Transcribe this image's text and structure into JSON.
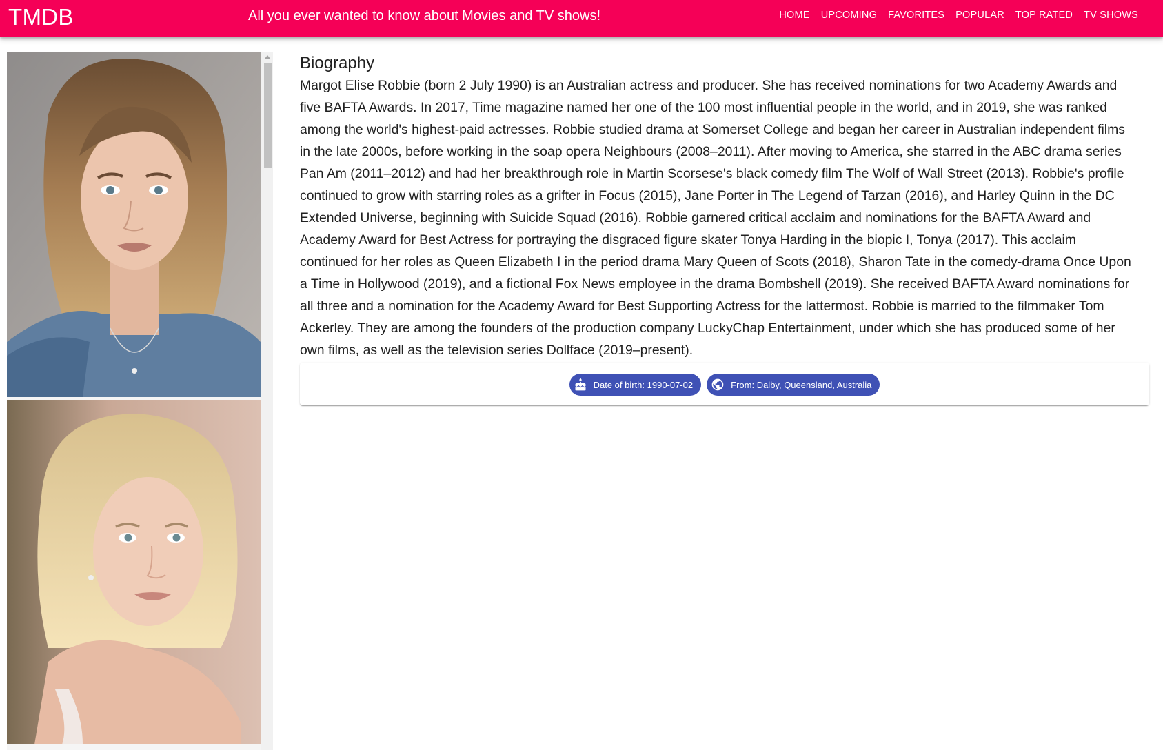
{
  "header": {
    "brand": "TMDB",
    "tagline": "All you ever wanted to know about Movies and TV shows!",
    "nav": [
      "HOME",
      "UPCOMING",
      "FAVORITES",
      "POPULAR",
      "TOP RATED",
      "TV SHOWS"
    ],
    "color": "#f50057"
  },
  "biography": {
    "title": "Biography",
    "text": "Margot Elise Robbie (born 2 July 1990) is an Australian actress and producer. She has received nominations for two Academy Awards and five BAFTA Awards. In 2017, Time magazine named her one of the 100 most influential people in the world, and in 2019, she was ranked among the world's highest-paid actresses. Robbie studied drama at Somerset College and began her career in Australian independent films in the late 2000s, before working in the soap opera Neighbours (2008–2011). After moving to America, she starred in the ABC drama series Pan Am (2011–2012) and had her breakthrough role in Martin Scorsese's black comedy film The Wolf of Wall Street (2013). Robbie's profile continued to grow with starring roles as a grifter in Focus (2015), Jane Porter in The Legend of Tarzan (2016), and Harley Quinn in the DC Extended Universe, beginning with Suicide Squad (2016). Robbie garnered critical acclaim and nominations for the BAFTA Award and Academy Award for Best Actress for portraying the disgraced figure skater Tonya Harding in the biopic I, Tonya (2017). This acclaim continued for her roles as Queen Elizabeth I in the period drama Mary Queen of Scots (2018), Sharon Tate in the comedy-drama Once Upon a Time in Hollywood (2019), and a fictional Fox News employee in the drama Bombshell (2019). She received BAFTA Award nominations for all three and a nomination for the Academy Award for Best Supporting Actress for the lattermost. Robbie is married to the filmmaker Tom Ackerley. They are among the founders of the production company LuckyChap Entertainment, under which she has produced some of her own films, as well as the television series Dollface (2019–present)."
  },
  "chips": {
    "birth": {
      "label": "Date of birth: 1990-07-02",
      "icon": "cake-icon"
    },
    "origin": {
      "label": "From: Dalby, Queensland, Australia",
      "icon": "globe-icon"
    },
    "color": "#3f51b5"
  },
  "gallery": {
    "images": [
      "portrait-photo",
      "portrait-photo"
    ]
  }
}
